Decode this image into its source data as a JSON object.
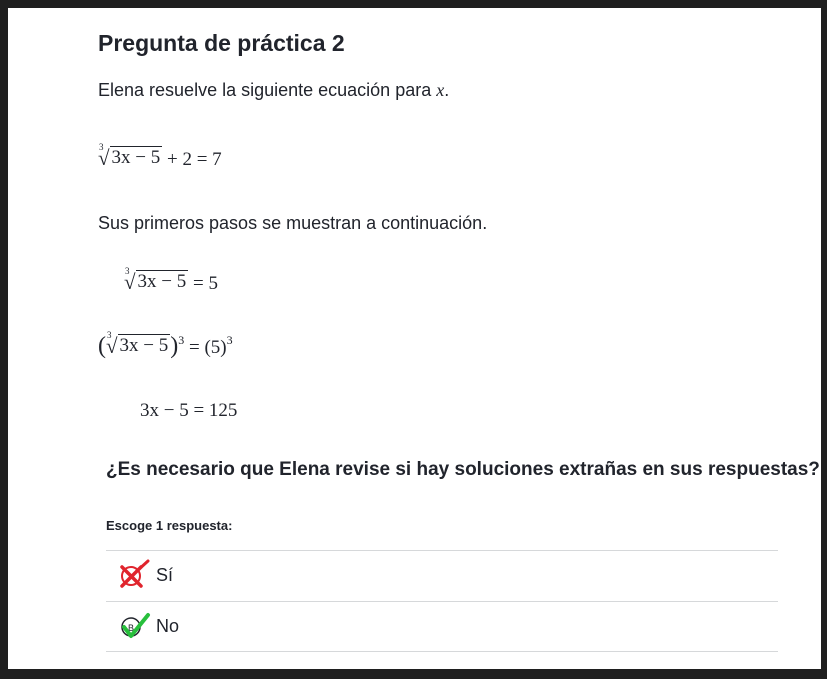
{
  "question": {
    "title": "Pregunta de práctica 2",
    "intro_prefix": "Elena resuelve la siguiente ecuación para",
    "intro_var": "x",
    "intro_suffix": ".",
    "equation": {
      "index": "3",
      "radicand": "3x − 5",
      "rest": "+ 2 = 7"
    },
    "steps_intro": "Sus primeros pasos se muestran a continuación.",
    "steps": {
      "step1_index": "3",
      "step1_radicand": "3x − 5",
      "step1_rest": "= 5",
      "step2_open": "(",
      "step2_index": "3",
      "step2_radicand": "3x − 5",
      "step2_close": ")",
      "step2_exp": "3",
      "step2_eq": "= (5)",
      "step2_exp_right": "3",
      "step3": "3x − 5 = 125"
    },
    "prompt": "¿Es necesario que Elena revise si hay soluciones extrañas en sus respuestas?"
  },
  "answers": {
    "instruction": "Escoge 1 respuesta:",
    "choices": [
      {
        "label": "Sí",
        "status": "incorrect-marked",
        "color": "#e0242d"
      },
      {
        "label": "No",
        "status": "correct-answer",
        "color": "#27bf3c"
      }
    ]
  }
}
